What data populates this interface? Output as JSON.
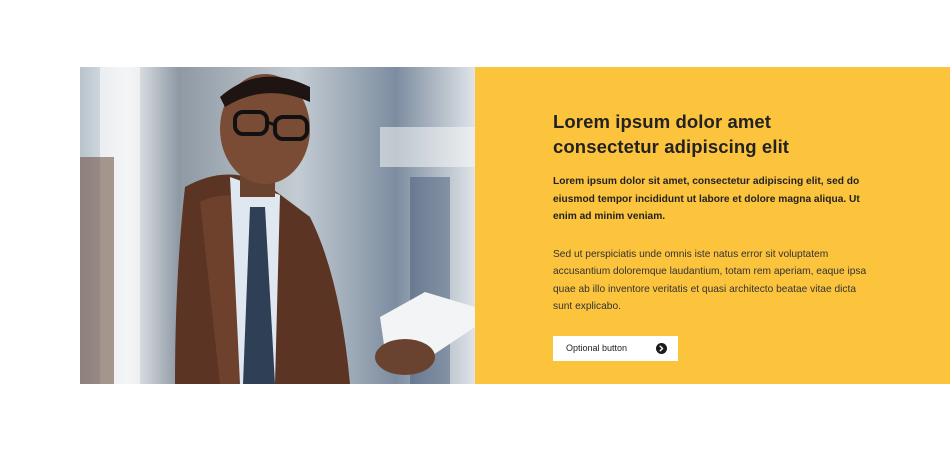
{
  "photo": {
    "alt": "Man with glasses in a brown leather jacket looking at a phone on a train"
  },
  "content": {
    "headline": "Lorem ipsum dolor amet consectetur adipiscing elit",
    "lead": "Lorem ipsum dolor sit amet, consectetur adipiscing elit, sed do eiusmod tempor incididunt ut labore et dolore magna aliqua. Ut enim ad minim veniam.",
    "body": "Sed ut perspiciatis unde omnis iste natus error sit voluptatem accusantium doloremque laudantium, totam rem aperiam, eaque ipsa quae ab illo inventore veritatis et quasi architecto beatae vitae dicta sunt explicabo.",
    "button_label": "Optional button",
    "button_icon": "arrow-right-circle-icon"
  },
  "colors": {
    "panel_bg": "#fcc33c",
    "text": "#222222",
    "button_bg": "#ffffff"
  }
}
